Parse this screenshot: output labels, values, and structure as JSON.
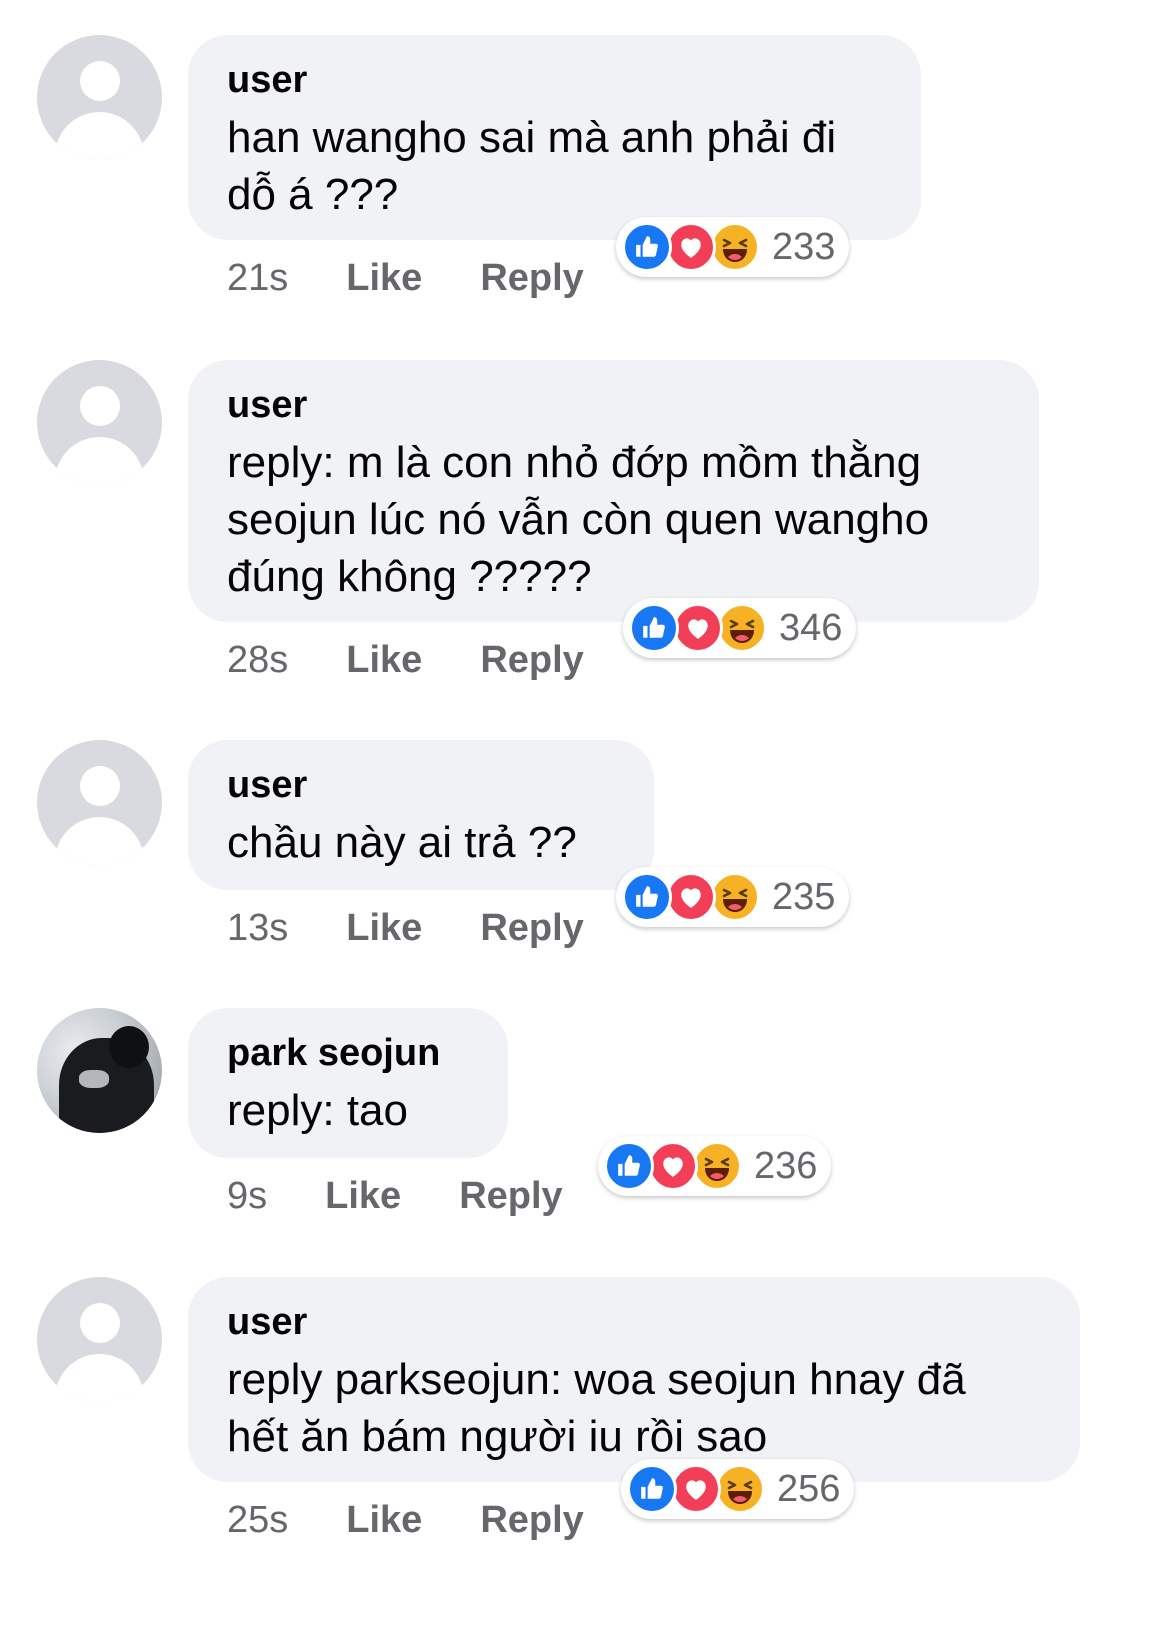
{
  "comments": [
    {
      "author": "user",
      "lines": [
        "han wangho sai mà anh phải đi",
        "dỗ á ???"
      ],
      "time": "21s",
      "like_label": "Like",
      "reply_label": "Reply",
      "reaction_count": "233",
      "avatar": "default-avatar"
    },
    {
      "author": "user",
      "lines": [
        "reply: m là con nhỏ đớp mồm thằng",
        "seojun lúc nó vẫn còn quen wangho",
        "đúng không ?????"
      ],
      "time": "28s",
      "like_label": "Like",
      "reply_label": "Reply",
      "reaction_count": "346",
      "avatar": "default-avatar"
    },
    {
      "author": "user",
      "lines": [
        "chầu này ai trả ??"
      ],
      "time": "13s",
      "like_label": "Like",
      "reply_label": "Reply",
      "reaction_count": "235",
      "avatar": "default-avatar"
    },
    {
      "author": "park seojun",
      "lines": [
        "reply: tao"
      ],
      "time": "9s",
      "like_label": "Like",
      "reply_label": "Reply",
      "reaction_count": "236",
      "avatar": "profile-photo"
    },
    {
      "author": "user",
      "lines": [
        "reply parkseojun: woa seojun hnay đã",
        "hết ăn bám người iu rồi sao"
      ],
      "time": "25s",
      "like_label": "Like",
      "reply_label": "Reply",
      "reaction_count": "256",
      "avatar": "default-avatar"
    }
  ],
  "reaction_icons": [
    "like-icon",
    "love-icon",
    "haha-icon"
  ],
  "colors": {
    "bubble": "#f0f2f5",
    "meta_text": "#65676b",
    "like_blue": "#1877f2",
    "love_red": "#f33e58",
    "haha_yellow": "#f7b125"
  }
}
